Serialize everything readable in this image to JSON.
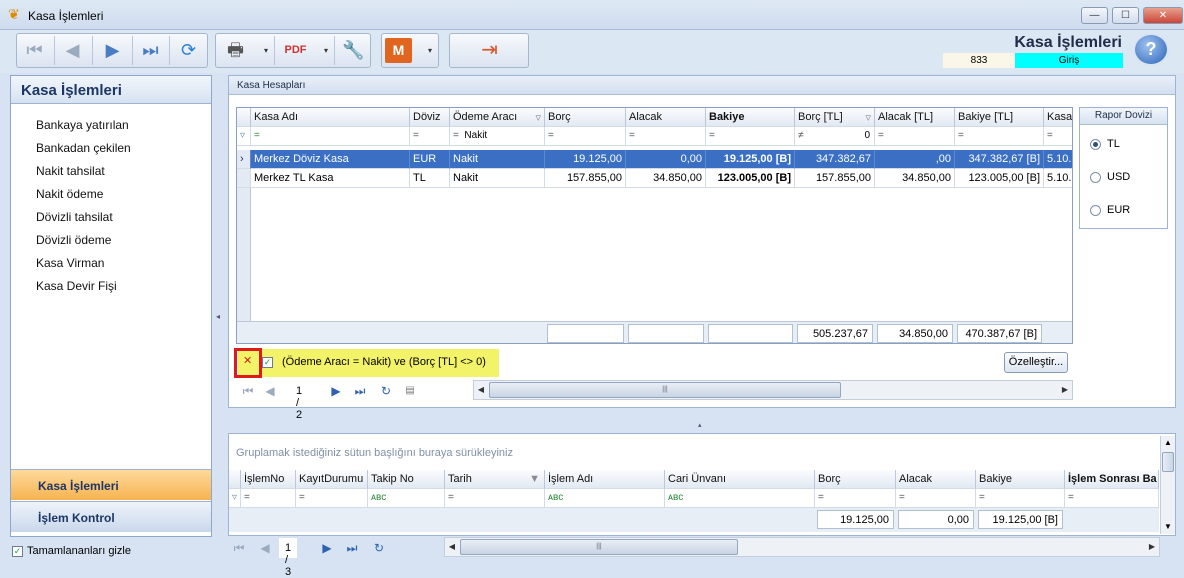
{
  "window": {
    "title": "Kasa İşlemleri",
    "min": "—",
    "max": "☐",
    "close": "✕"
  },
  "header": {
    "title": "Kasa İşlemleri",
    "number": "833",
    "mode": "Giriş",
    "help": "?"
  },
  "sidebar": {
    "title": "Kasa İşlemleri",
    "items": [
      "Bankaya yatırılan",
      "Bankadan çekilen",
      "Nakit tahsilat",
      "Nakit ödeme",
      "Dövizli tahsilat",
      "Dövizli ödeme",
      "Kasa Virman",
      "Kasa Devir Fişi"
    ],
    "nav1": "Kasa İşlemleri",
    "nav2": "İşlem Kontrol",
    "hide_completed": "Tamamlananları gizle"
  },
  "top": {
    "caption": "Kasa Hesapları",
    "columns": [
      "Kasa Adı",
      "Döviz",
      "Ödeme Aracı",
      "Borç",
      "Alacak",
      "Bakiye",
      "Borç [TL]",
      "Alacak [TL]",
      "Bakiye [TL]",
      "Kasa"
    ],
    "filter": {
      "kasa": "=",
      "doviz": "=",
      "odeme_op": "=",
      "odeme_val": "Nakit",
      "borc": "=",
      "alacak": "=",
      "bakiye": "=",
      "borctl_op": "≠",
      "borctl_val": "0",
      "alacaktl": "=",
      "bakiyetl": "="
    },
    "rows": [
      [
        "Merkez Döviz Kasa",
        "EUR",
        "Nakit",
        "19.125,00",
        "0,00",
        "19.125,00 [B]",
        "347.382,67",
        ",00",
        "347.382,67 [B]",
        "5.10."
      ],
      [
        "Merkez TL Kasa",
        "TL",
        "Nakit",
        "157.855,00",
        "34.850,00",
        "123.005,00 [B]",
        "157.855,00",
        "34.850,00",
        "123.005,00 [B]",
        "5.10."
      ]
    ],
    "totals": {
      "borctl": "505.237,67",
      "alacaktl": "34.850,00",
      "bakiyetl": "470.387,67 [B]"
    },
    "filter_text": "(Ödeme Aracı = Nakit) ve (Borç [TL] <> 0)",
    "customize": "Özelleştir...",
    "page": "1 / 2"
  },
  "rapor": {
    "title": "Rapor Dovizi",
    "options": [
      "TL",
      "USD",
      "EUR"
    ],
    "selected": "TL"
  },
  "bottom": {
    "group_hint": "Gruplamak istediğiniz sütun başlığını buraya sürükleyiniz",
    "columns": [
      "İşlemNo",
      "KayıtDurumu",
      "Takip No",
      "Tarih",
      "İşlem Adı",
      "Cari Ünvanı",
      "Borç",
      "Alacak",
      "Bakiye",
      "İşlem Sonrası Ba"
    ],
    "filter": {
      "islemno": "=",
      "kayit": "=",
      "takip": "ᴀʙc",
      "tarih": "=",
      "islem": "ᴀʙc",
      "cari": "ᴀʙc",
      "borc": "=",
      "alacak": "=",
      "bakiye": "=",
      "sonrasi": "="
    },
    "totals": {
      "borc": "19.125,00",
      "alacak": "0,00",
      "bakiye": "19.125,00 [B]"
    },
    "page": "1 / 3"
  }
}
